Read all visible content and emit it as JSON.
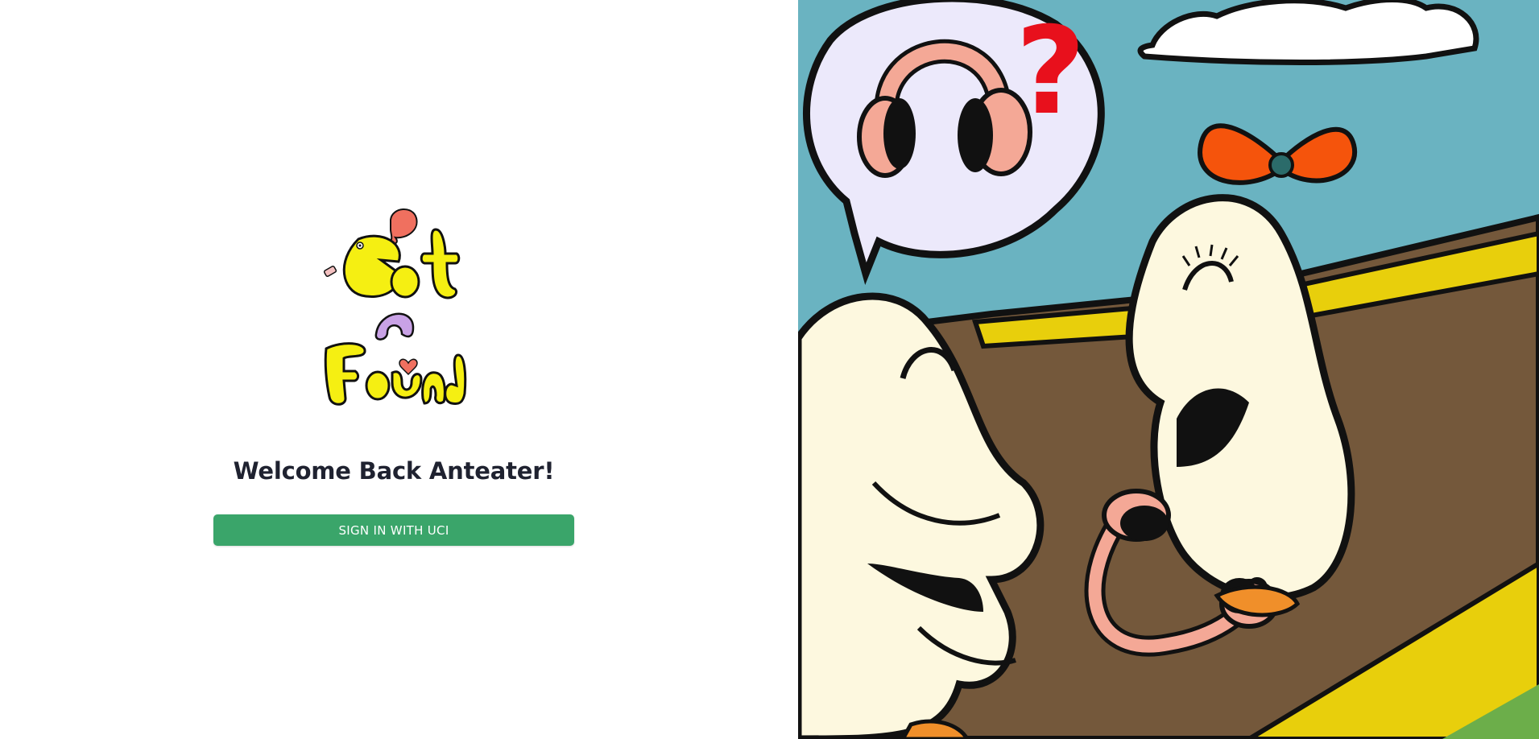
{
  "login": {
    "logo_text": "Got 'n Found",
    "welcome": "Welcome Back Anteater!",
    "signin_label": "SIGN IN WITH UCI"
  },
  "colors": {
    "button": "#3aa56a",
    "title": "#1f2230",
    "sky": "#6ab3c1",
    "ground": "#74583b",
    "character": "#fdf8df"
  },
  "illustration": {
    "question_mark": "?"
  }
}
